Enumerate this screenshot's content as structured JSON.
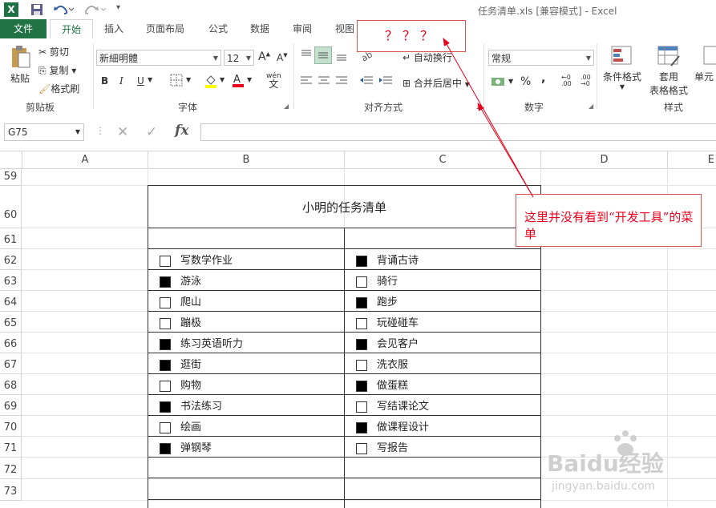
{
  "title_bar": {
    "app_icon": "X",
    "title": "任务清单.xls  [兼容模式] - Excel"
  },
  "tabs": [
    "文件",
    "开始",
    "插入",
    "页面布局",
    "公式",
    "数据",
    "审阅",
    "视图"
  ],
  "ribbon": {
    "clipboard": {
      "paste": "粘贴",
      "cut": "剪切",
      "copy": "复制",
      "format_painter": "格式刷",
      "label": "剪贴板"
    },
    "font": {
      "font_name": "新細明體",
      "font_size": "12",
      "bold": "B",
      "italic": "I",
      "underline": "U",
      "label": "字体",
      "wen": "wén",
      "wen_char": "文"
    },
    "alignment": {
      "wrap": "自动换行",
      "merge": "合并后居中",
      "label": "对齐方式"
    },
    "number": {
      "format": "常规",
      "percent": "%",
      "comma": ",",
      "label": "数字"
    },
    "styles": {
      "cond_format": "条件格式",
      "table_format_1": "套用",
      "table_format_2": "表格格式",
      "cell_styles": "单元",
      "label": "样式"
    }
  },
  "formula_bar": {
    "name_box": "G75",
    "fx": "fx"
  },
  "columns": [
    "A",
    "B",
    "C",
    "D",
    "E"
  ],
  "rows": [
    "59",
    "60",
    "61",
    "62",
    "63",
    "64",
    "65",
    "66",
    "67",
    "68",
    "69",
    "70",
    "71",
    "72",
    "73"
  ],
  "sheet": {
    "table_title": "小明的任务清单",
    "tasks": [
      {
        "left": "写数学作业",
        "left_checked": false,
        "right": "背诵古诗",
        "right_checked": true
      },
      {
        "left": "游泳",
        "left_checked": true,
        "right": "骑行",
        "right_checked": false
      },
      {
        "left": "爬山",
        "left_checked": false,
        "right": "跑步",
        "right_checked": true
      },
      {
        "left": "蹦极",
        "left_checked": false,
        "right": "玩碰碰车",
        "right_checked": false
      },
      {
        "left": "练习英语听力",
        "left_checked": true,
        "right": "会见客户",
        "right_checked": true
      },
      {
        "left": "逛街",
        "left_checked": true,
        "right": "洗衣服",
        "right_checked": false
      },
      {
        "left": "购物",
        "left_checked": false,
        "right": "做蛋糕",
        "right_checked": true
      },
      {
        "left": "书法练习",
        "left_checked": true,
        "right": "写结课论文",
        "right_checked": false
      },
      {
        "left": "绘画",
        "left_checked": false,
        "right": "做课程设计",
        "right_checked": true
      },
      {
        "left": "弹钢琴",
        "left_checked": true,
        "right": "写报告",
        "right_checked": false
      }
    ]
  },
  "annotations": {
    "question": "？？？",
    "note": "这里并没有看到“开发工具”的菜单",
    "color": "#e8001c"
  },
  "watermark": {
    "brand": "Baidu经验",
    "url": "jingyan.baidu.com"
  },
  "colors": {
    "excel_green": "#217346",
    "accent_red": "#e8001c"
  }
}
